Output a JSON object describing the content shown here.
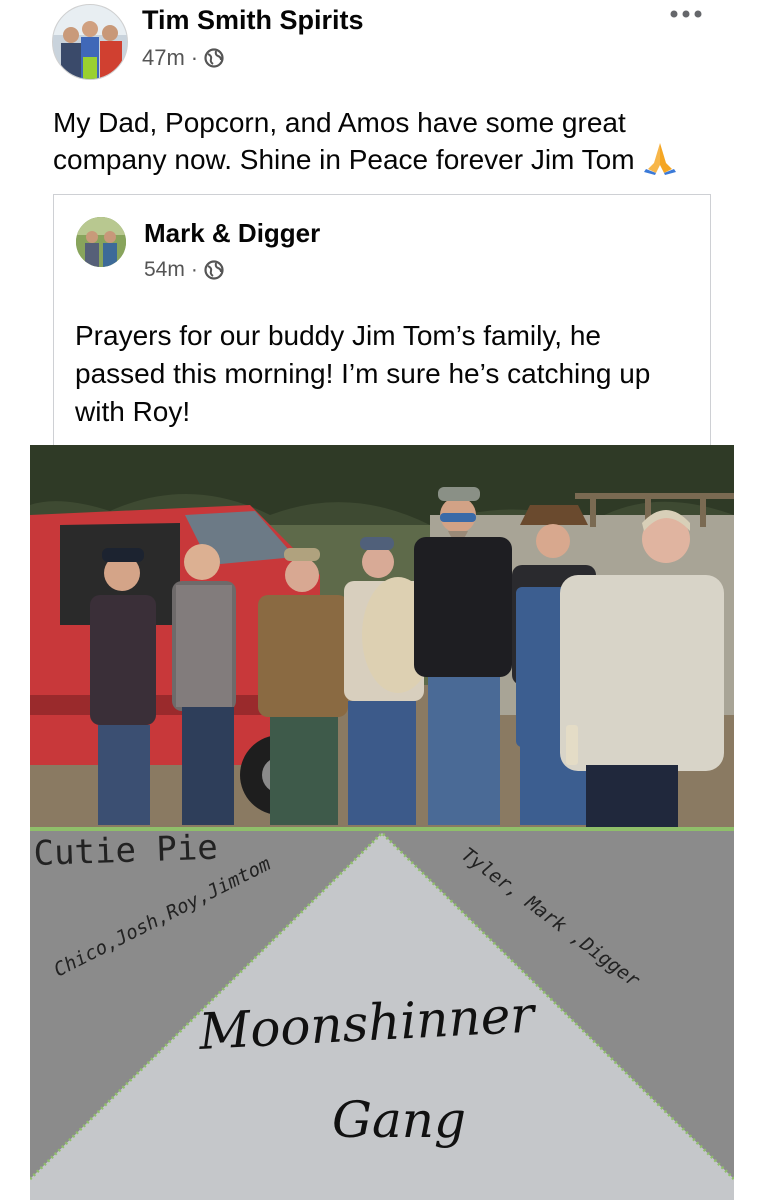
{
  "post": {
    "author": "Tim Smith Spirits",
    "time": "47m",
    "separator": "·",
    "text": "My Dad, Popcorn, and Amos have some great company now. Shine in Peace forever Jim Tom",
    "more_icon": "more-horizontal-icon",
    "privacy_icon": "globe-icon",
    "emoji": "praying-hands-emoji"
  },
  "shared": {
    "author": "Mark & Digger",
    "time": "54m",
    "separator": "·",
    "text": "Prayers for our buddy Jim Tom’s family, he passed this morning! I’m sure he’s catching up with Roy!"
  },
  "image": {
    "banner_left_title": "Cutie Pie",
    "banner_left_names": "Chico,Josh,Roy,Jimtom",
    "banner_right_names": "Tyler, Mark ,Digger",
    "banner_center_line1": "Moonshinner",
    "banner_center_line2": "Gang"
  },
  "colors": {
    "banner_gray": "#8b8b8b",
    "banner_light": "#c5c7ca",
    "banner_green_border": "#8fbf6a",
    "truck_red": "#c8383a"
  }
}
